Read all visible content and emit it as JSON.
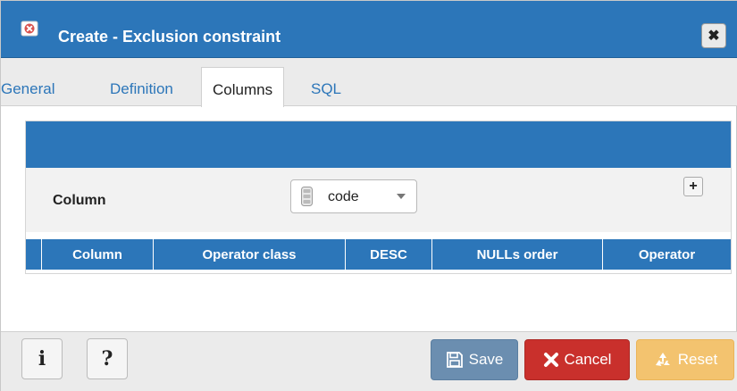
{
  "dialog": {
    "title": "Create - Exclusion constraint",
    "title_icon": "exclusion-constraint-icon",
    "close_label": "✖"
  },
  "tabs": [
    {
      "label": "General",
      "active": false
    },
    {
      "label": "Definition",
      "active": false
    },
    {
      "label": "Columns",
      "active": true
    },
    {
      "label": "SQL",
      "active": false
    }
  ],
  "columns_panel": {
    "column_label": "Column",
    "column_select_value": "code",
    "add_label": "+",
    "grid_headers": [
      "Column",
      "Operator class",
      "DESC",
      "NULLs order",
      "Operator"
    ]
  },
  "footer": {
    "info_label": "i",
    "help_label": "?",
    "save_label": "Save",
    "cancel_label": "Cancel",
    "reset_label": "Reset"
  },
  "colors": {
    "primary": "#2c76b9",
    "save": "#6b8eb0",
    "cancel": "#c9302c",
    "reset": "#f3c36f"
  }
}
